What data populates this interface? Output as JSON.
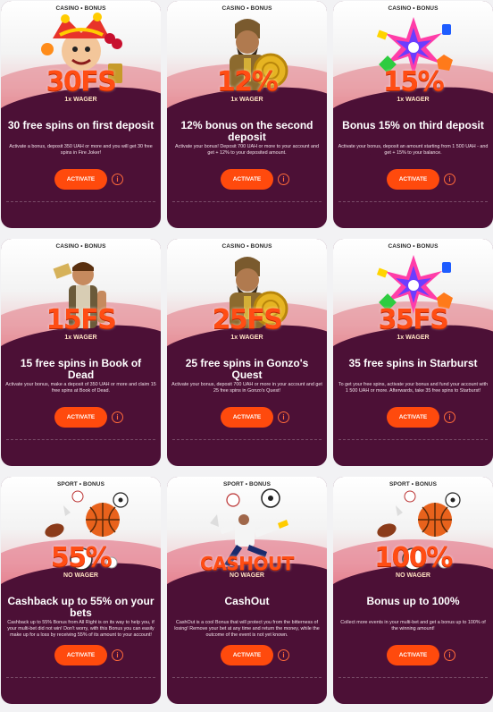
{
  "cards": [
    {
      "tag": "CASINO • BONUS",
      "big": "30FS",
      "wager": "1x WAGER",
      "title": "30 free spins on first deposit",
      "desc": "Activate a bonus, deposit 350 UAH or more and you will get 30 free spins in Fire Joker!",
      "button": "ACTIVATE",
      "art": "joker-character-icon"
    },
    {
      "tag": "CASINO • BONUS",
      "big": "12%",
      "wager": "1x WAGER",
      "title": "12% bonus on the second deposit",
      "desc": "Activate your bonus! Deposit 700 UAH or more to your account and get + 12% to your deposited amount.",
      "button": "ACTIVATE",
      "art": "gonzo-character-icon"
    },
    {
      "tag": "CASINO • BONUS",
      "big": "15%",
      "wager": "1x WAGER",
      "title": "Bonus 15% on third deposit",
      "desc": "Activate your bonus, deposit an amount starting from 1 500 UAH - and get + 15% to your balance.",
      "button": "ACTIVATE",
      "art": "starburst-gems-icon"
    },
    {
      "tag": "CASINO • BONUS",
      "big": "15FS",
      "wager": "1x WAGER",
      "title": "15 free spins in Book of Dead",
      "desc": "Activate your bonus, make a deposit of 350 UAH or more and claim 15 free spins at Book of Dead.",
      "button": "ACTIVATE",
      "art": "explorer-character-icon"
    },
    {
      "tag": "CASINO • BONUS",
      "big": "25FS",
      "wager": "1x WAGER",
      "title": "25 free spins in Gonzo's Quest",
      "desc": "Activate your bonus, deposit 700 UAH or more in your account and get 25 free spins in Gonzo's Quest!",
      "button": "ACTIVATE",
      "art": "gonzo-character-icon"
    },
    {
      "tag": "CASINO • BONUS",
      "big": "35FS",
      "wager": "1x WAGER",
      "title": "35 free spins in Starburst",
      "desc": "To get your free spins, activate your bonus and fund your account with 1 500 UAH or more. Afterwards, take 35 free spins to Starburst!",
      "button": "ACTIVATE",
      "art": "starburst-gems-icon"
    },
    {
      "tag": "SPORT • BONUS",
      "big": "55%",
      "wager": "NO WAGER",
      "title": "Cashback up to 55% on your bets",
      "desc": "Cashback up to 55% Bonus from All Right is on its way to help you, if your multi-bet did not win! Don't worry, with this Bonus you can easily make up for a loss by receiving 55% of its amount to your account!",
      "button": "ACTIVATE",
      "art": "sports-balls-icon"
    },
    {
      "tag": "SPORT • BONUS",
      "big": "CASHOUT",
      "wager": "NO WAGER",
      "title": "CashOut",
      "desc": "CashOut is a cool Bonus that will protect you from the bitterness of losing! Remove your bet at any time and return the money, while the outcome of the event is not yet known.",
      "button": "ACTIVATE",
      "art": "soccer-player-icon"
    },
    {
      "tag": "SPORT • BONUS",
      "big": "100%",
      "wager": "NO WAGER",
      "title": "Bonus up to 100%",
      "desc": "Collect more events in your multi-bet and get a bonus up to 100% of the winning amount!",
      "button": "ACTIVATE",
      "art": "sports-balls-icon"
    }
  ],
  "info_glyph": "i",
  "colors": {
    "accent": "#ff4a0d",
    "card_bg": "#4c1036",
    "big_text": "#ff4d14"
  }
}
